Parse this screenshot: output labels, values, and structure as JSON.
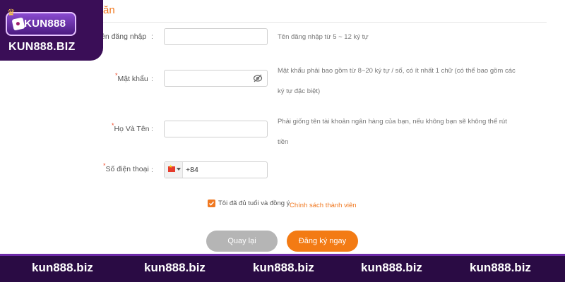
{
  "brand": {
    "logo_word": "KUN888",
    "domain": "KUN888.BIZ",
    "accent": "#f07820",
    "footer_bg": "#2a0b44"
  },
  "form": {
    "section_title_partial": "ăn",
    "fields": [
      {
        "label": "ên đăng nhập",
        "required": false,
        "value": "",
        "hint_lines": [
          "Tên đăng nhập từ 5 ~ 12 ký tự"
        ]
      },
      {
        "label": "Mật khẩu",
        "required": true,
        "value": "",
        "icon": "eye-hidden-icon",
        "hint_lines": [
          "Mật khẩu phải bao gồm từ 8~20 ký tự / số, có ít nhất 1 chữ (có thể bao gồm các",
          "ký tự đặc biệt)"
        ]
      },
      {
        "label": "Họ Và Tên",
        "required": true,
        "value": "",
        "hint_lines": [
          "Phải giống tên tài khoản ngân hàng của bạn, nếu không bạn sẽ không thể rút",
          "tiền"
        ]
      },
      {
        "label": "Số điện thoại",
        "required": true,
        "country_flag": "vietnam-flag-icon",
        "value": "+84"
      }
    ],
    "colon": ":",
    "agree_text": "Tôi đã đủ tuổi và đồng ý",
    "agree_link": "Chính sách thành viên",
    "agree_checked": true,
    "back_label": "Quay lại",
    "register_label": "Đăng ký ngay"
  },
  "footer": {
    "items": [
      "kun888.biz",
      "kun888.biz",
      "kun888.biz",
      "kun888.biz",
      "kun888.biz"
    ]
  }
}
